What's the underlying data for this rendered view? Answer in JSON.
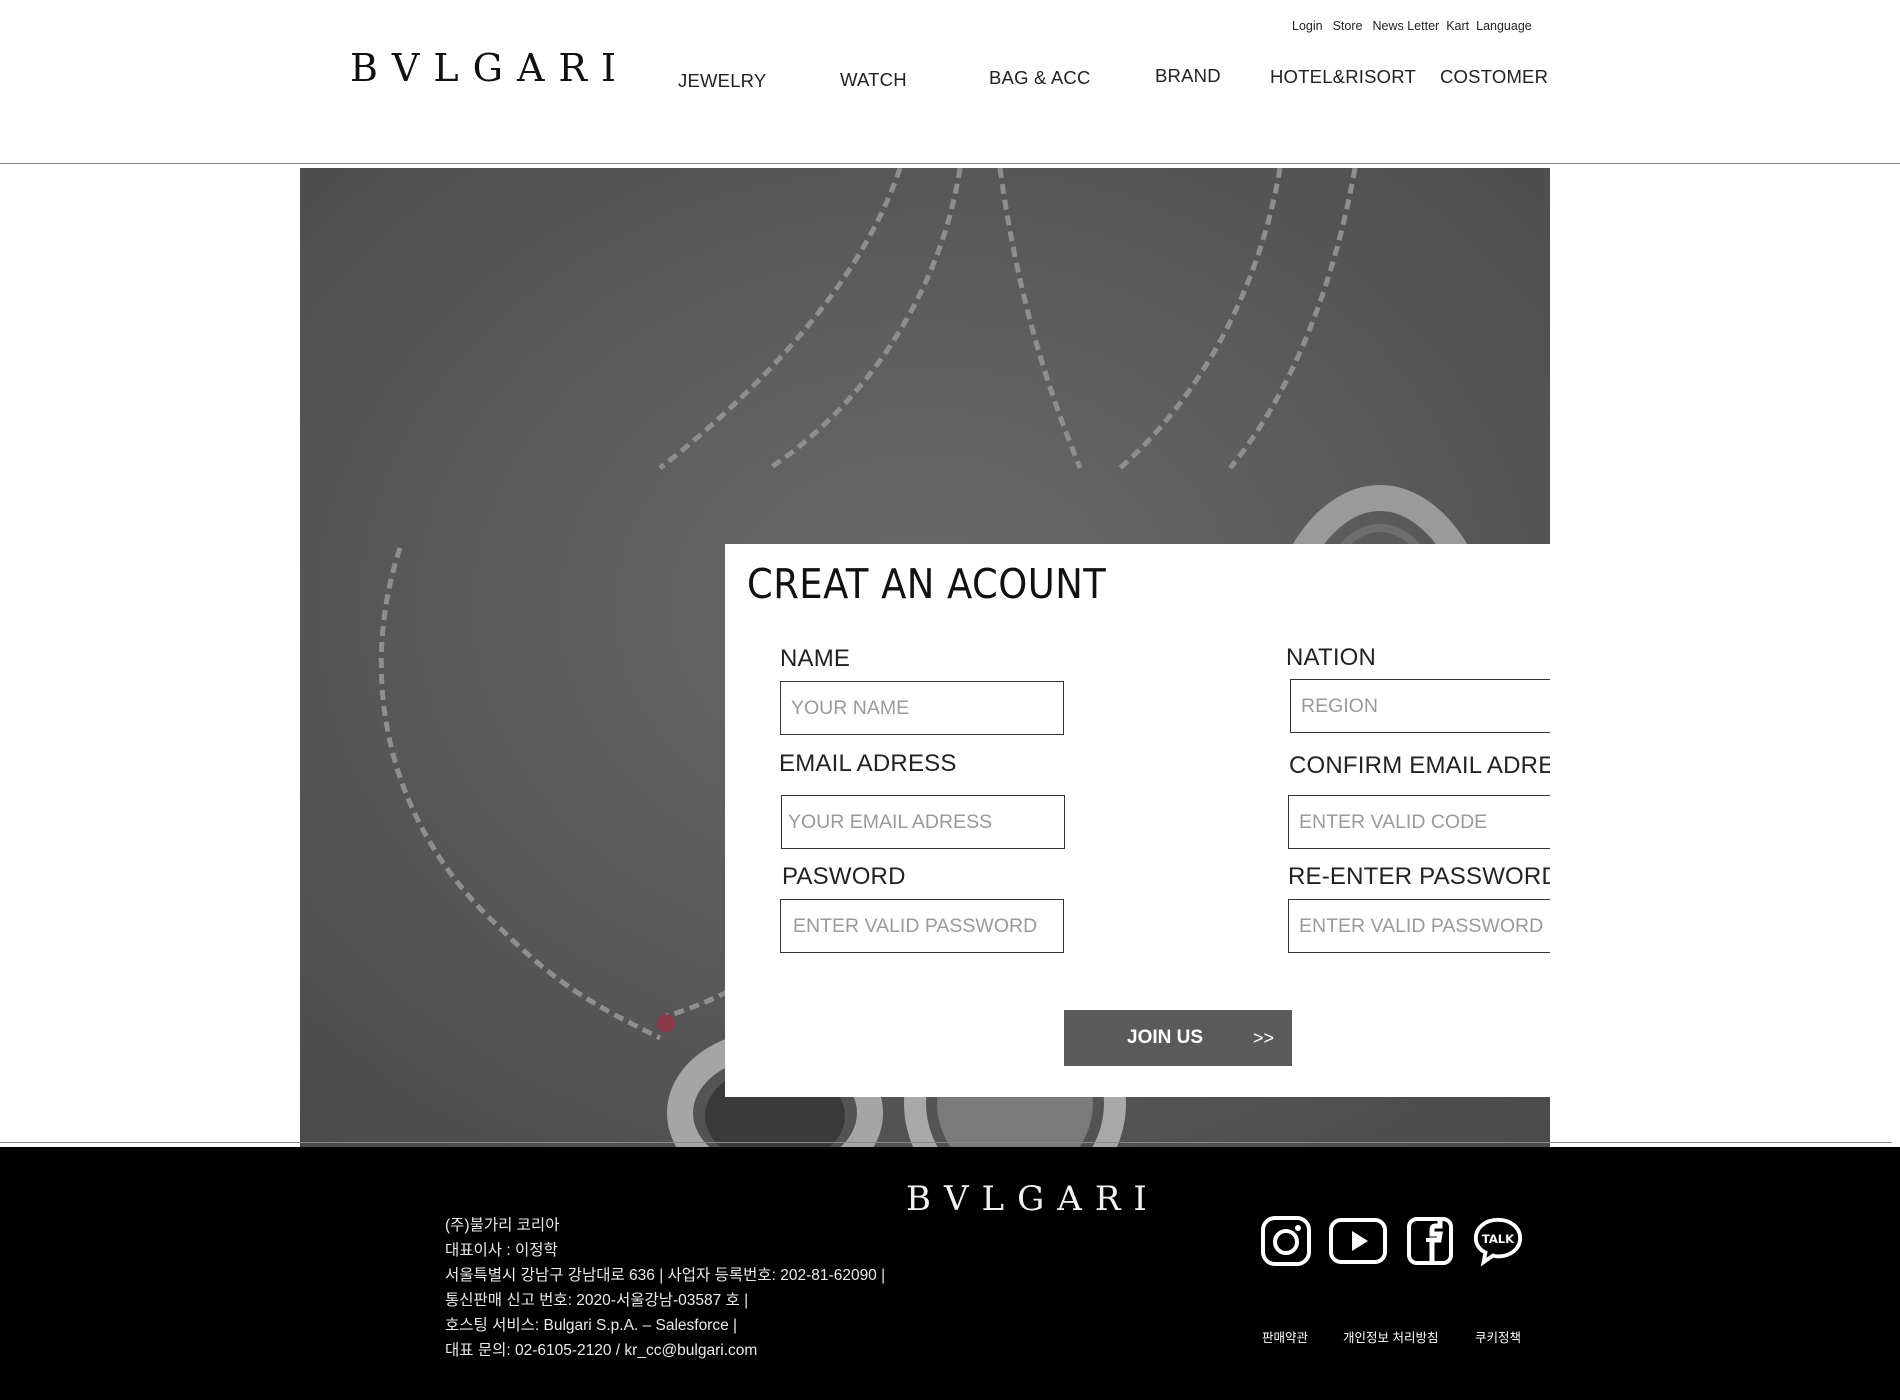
{
  "header": {
    "logo": "BVLGARI",
    "util_links": [
      "Login",
      "Store",
      "News Letter",
      "Kart",
      "Language"
    ],
    "nav": [
      "JEWELRY",
      "WATCH",
      "BAG & ACC",
      "BRAND",
      "HOTEL&RISORT",
      "COSTOMER"
    ]
  },
  "form": {
    "title": "CREAT AN ACOUNT",
    "fields": [
      {
        "label": "NAME",
        "placeholder": "YOUR NAME"
      },
      {
        "label": "NATION",
        "placeholder": "REGION"
      },
      {
        "label": "EMAIL ADRESS",
        "placeholder": "YOUR EMAIL ADRESS"
      },
      {
        "label": "CONFIRM EMAIL ADRESS",
        "placeholder": "ENTER VALID CODE"
      },
      {
        "label": "PASWORD",
        "placeholder": "ENTER VALID PASSWORD"
      },
      {
        "label": "RE-ENTER PASSWORD",
        "placeholder": "ENTER VALID PASSWORD"
      }
    ],
    "submit_label": "JOIN US",
    "submit_arrow": ">>"
  },
  "footer": {
    "logo": "BVLGARI",
    "company_lines": [
      "(주)불가리 코리아",
      "대표이사 : 이정학",
      "서울특별시 강남구 강남대로 636 | 사업자 등록번호: 202-81-62090 |",
      "통신판매 신고 번호: 2020-서울강남-03587 호 |",
      "호스팅 서비스: Bulgari S.p.A. – Salesforce |",
      "대표 문의: 02-6105-2120 / kr_cc@bulgari.com"
    ],
    "social_icons": [
      "instagram-icon",
      "youtube-icon",
      "facebook-icon",
      "kakaotalk-icon"
    ],
    "talk_label": "TALK",
    "legal_links": [
      "판매약관",
      "개인정보 처리방침",
      "쿠키정책"
    ]
  },
  "colors": {
    "hero_bg": "#545454",
    "button_bg": "#5a5a5a",
    "footer_bg": "#000000"
  }
}
